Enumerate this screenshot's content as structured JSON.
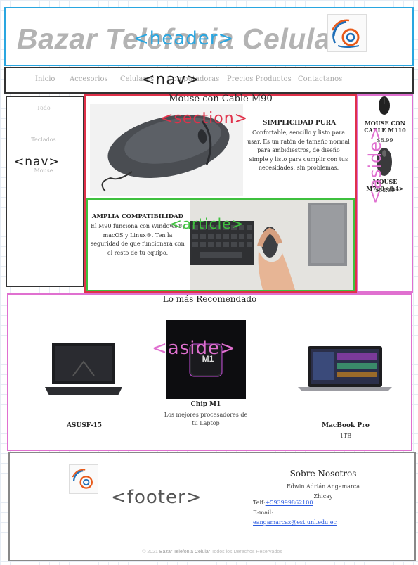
{
  "header": {
    "title": "Bazar Telefonia Celular"
  },
  "nav": {
    "items": [
      "Inicio",
      "Accesorios",
      "Celulares",
      "Computadoras",
      "Precios Productos",
      "Contactanos"
    ]
  },
  "side_nav": {
    "items": [
      "Todo",
      "Teclados",
      "Mouse"
    ]
  },
  "section": {
    "title": "Mouse con Cable M90",
    "feature_title": "SIMPLICIDAD PURA",
    "feature_text": "Confortable, sencillo y listo para usar. Es un ratón de tamaño normal para ambidiestros, de diseño simple y listo para cumplir con tus necesidades, sin problemas."
  },
  "article": {
    "title": "AMPLIA COMPATIBILIDAD",
    "text": "El M90 funciona con Windows®, macOS y Linux®. Ten la seguridad de que funcionará con el resto de tu equipo."
  },
  "aside": {
    "items": [
      {
        "name": "MOUSE CON CABLE M110",
        "price": "$8.99"
      },
      {
        "name": "MOUSE M720</h4>",
        "price": "$58.99"
      }
    ]
  },
  "recommended": {
    "title": "Lo más Recomendado",
    "products": [
      {
        "name": "ASUSF-15",
        "desc": ""
      },
      {
        "name": "Chip M1",
        "desc": "Los mejores procesadores de tu Laptop",
        "chip_label": "M1"
      },
      {
        "name": "MacBook Pro",
        "desc": "1TB"
      }
    ]
  },
  "footer": {
    "about_title": "Sobre Nosotros",
    "author": "Edwin Adrián Angamarca Zhicay",
    "tel_label": "Telf:",
    "tel": "+593999862100",
    "email_label": "E-mail:",
    "email": "eangamarcaz@est.unl.edu.ec",
    "copyright_year": "© 2021",
    "copyright_site": "Bazar Telefonia Celular",
    "copyright_text": "Todos los Derechos Reservados"
  },
  "annotations": {
    "header": "<header>",
    "nav_top": "<nav>",
    "nav_side": "<nav>",
    "section": "<section>",
    "article": "<article>",
    "aside_right": "<aside>",
    "aside_rec": "<aside>",
    "footer": "<footer>"
  },
  "colors": {
    "header_border": "#2aa6e0",
    "nav_border": "#333333",
    "section_border": "#e0314a",
    "article_border": "#3ec03e",
    "aside_border": "#e070d0",
    "footer_border": "#888888",
    "link": "#2a5adf"
  }
}
